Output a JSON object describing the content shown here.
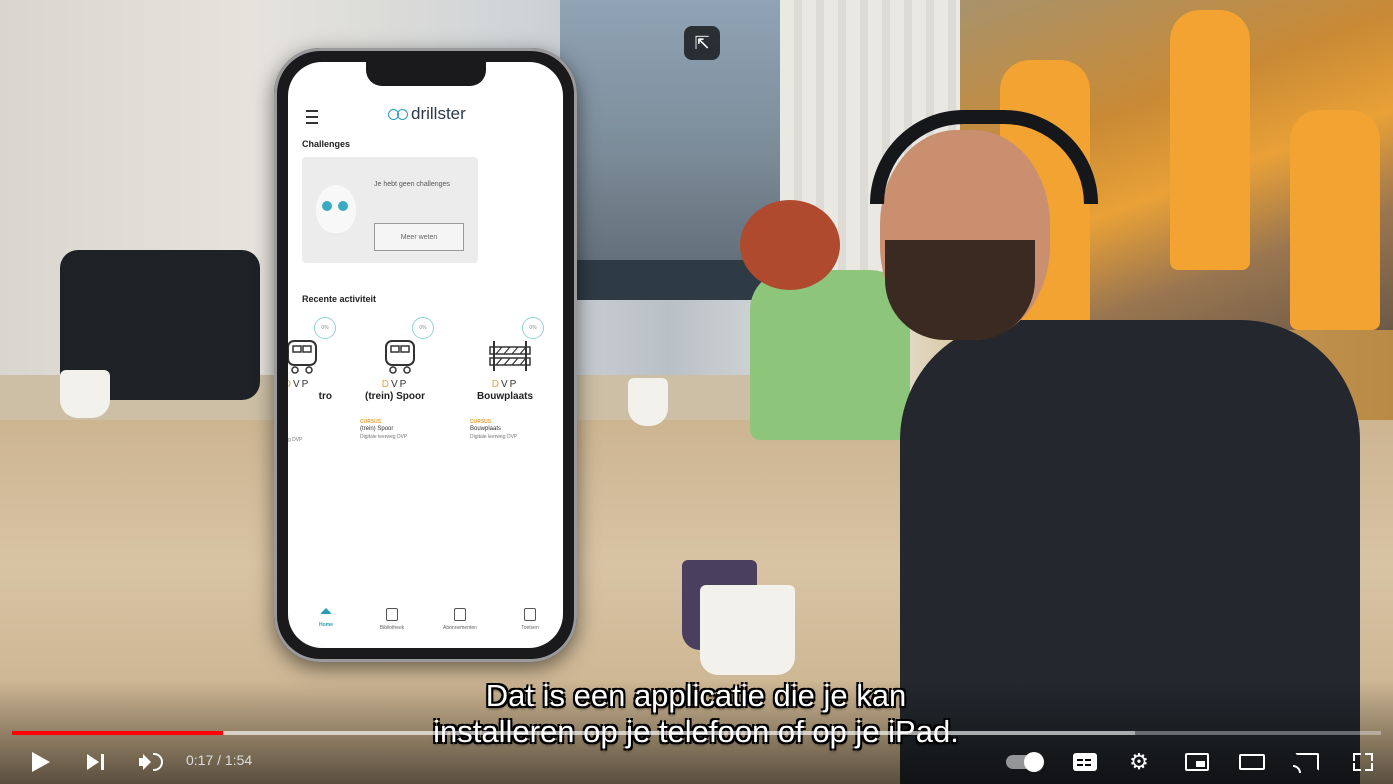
{
  "overlay": {
    "exit_miniplayer_glyph": "⇱"
  },
  "app": {
    "logo_text": "drillster",
    "challenges": {
      "title": "Challenges",
      "empty_text": "Je hebt geen challenges",
      "button_label": "Meer weten"
    },
    "recent": {
      "title": "Recente activiteit",
      "courses": [
        {
          "badge": "0%",
          "dvp_d": "D",
          "dvp_vp": "VP",
          "name": "tro",
          "type": "",
          "title": "",
          "subtitle": "g DVP"
        },
        {
          "badge": "0%",
          "dvp_d": "D",
          "dvp_vp": "VP",
          "name": "(trein) Spoor",
          "type": "CURSUS",
          "title": "(trein) Spoor",
          "subtitle": "Digitale leerweg DVP"
        },
        {
          "badge": "0%",
          "dvp_d": "D",
          "dvp_vp": "VP",
          "name": "Bouwplaats",
          "type": "CURSUS",
          "title": "Bouwplaats",
          "subtitle": "Digitale leerweg DVP"
        }
      ]
    },
    "tabs": [
      {
        "label": "Home",
        "icon": "home-icon"
      },
      {
        "label": "Bibliotheek",
        "icon": "library-icon"
      },
      {
        "label": "Abonnementen",
        "icon": "subscriptions-icon"
      },
      {
        "label": "Toetsen",
        "icon": "tests-icon"
      }
    ]
  },
  "subtitles": {
    "line1": "Dat is een applicatie die je kan",
    "line2": "installeren op je telefoon of op je iPad."
  },
  "player": {
    "time_display": "0:17 / 1:54",
    "progress_played": 0.154,
    "progress_loaded": 0.82,
    "accent_color": "#ff0000",
    "settings_glyph": "⚙"
  }
}
